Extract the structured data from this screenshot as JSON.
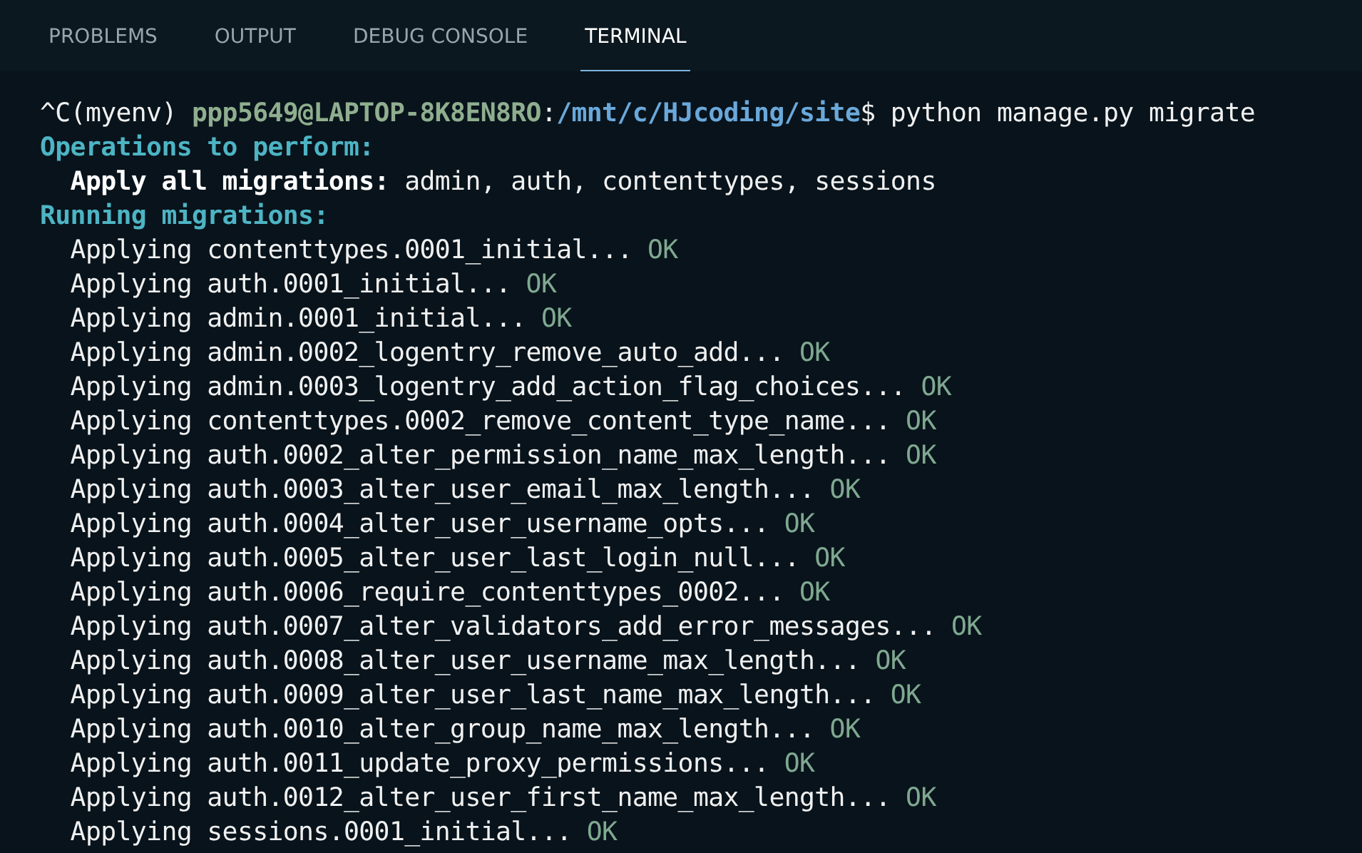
{
  "tabs": [
    {
      "label": "PROBLEMS",
      "selected": false
    },
    {
      "label": "OUTPUT",
      "selected": false
    },
    {
      "label": "DEBUG CONSOLE",
      "selected": false
    },
    {
      "label": "TERMINAL",
      "selected": true
    }
  ],
  "terminal": {
    "lines": [
      [
        {
          "kind": "plain",
          "text": "^C(myenv) "
        },
        {
          "kind": "user",
          "text": "ppp5649@LAPTOP-8K8EN8RO"
        },
        {
          "kind": "plain",
          "text": ":"
        },
        {
          "kind": "path",
          "text": "/mnt/c/HJcoding/site"
        },
        {
          "kind": "plain",
          "text": "$ python manage.py migrate"
        }
      ],
      [
        {
          "kind": "heading",
          "text": "Operations to perform:"
        }
      ],
      [
        {
          "kind": "label",
          "text": "  Apply all migrations:"
        },
        {
          "kind": "plain",
          "text": " admin, auth, contenttypes, sessions"
        }
      ],
      [
        {
          "kind": "heading",
          "text": "Running migrations:"
        }
      ],
      [
        {
          "kind": "plain",
          "text": "  Applying contenttypes.0001_initial... "
        },
        {
          "kind": "ok",
          "text": "OK"
        }
      ],
      [
        {
          "kind": "plain",
          "text": "  Applying auth.0001_initial... "
        },
        {
          "kind": "ok",
          "text": "OK"
        }
      ],
      [
        {
          "kind": "plain",
          "text": "  Applying admin.0001_initial... "
        },
        {
          "kind": "ok",
          "text": "OK"
        }
      ],
      [
        {
          "kind": "plain",
          "text": "  Applying admin.0002_logentry_remove_auto_add... "
        },
        {
          "kind": "ok",
          "text": "OK"
        }
      ],
      [
        {
          "kind": "plain",
          "text": "  Applying admin.0003_logentry_add_action_flag_choices... "
        },
        {
          "kind": "ok",
          "text": "OK"
        }
      ],
      [
        {
          "kind": "plain",
          "text": "  Applying contenttypes.0002_remove_content_type_name... "
        },
        {
          "kind": "ok",
          "text": "OK"
        }
      ],
      [
        {
          "kind": "plain",
          "text": "  Applying auth.0002_alter_permission_name_max_length... "
        },
        {
          "kind": "ok",
          "text": "OK"
        }
      ],
      [
        {
          "kind": "plain",
          "text": "  Applying auth.0003_alter_user_email_max_length... "
        },
        {
          "kind": "ok",
          "text": "OK"
        }
      ],
      [
        {
          "kind": "plain",
          "text": "  Applying auth.0004_alter_user_username_opts... "
        },
        {
          "kind": "ok",
          "text": "OK"
        }
      ],
      [
        {
          "kind": "plain",
          "text": "  Applying auth.0005_alter_user_last_login_null... "
        },
        {
          "kind": "ok",
          "text": "OK"
        }
      ],
      [
        {
          "kind": "plain",
          "text": "  Applying auth.0006_require_contenttypes_0002... "
        },
        {
          "kind": "ok",
          "text": "OK"
        }
      ],
      [
        {
          "kind": "plain",
          "text": "  Applying auth.0007_alter_validators_add_error_messages... "
        },
        {
          "kind": "ok",
          "text": "OK"
        }
      ],
      [
        {
          "kind": "plain",
          "text": "  Applying auth.0008_alter_user_username_max_length... "
        },
        {
          "kind": "ok",
          "text": "OK"
        }
      ],
      [
        {
          "kind": "plain",
          "text": "  Applying auth.0009_alter_user_last_name_max_length... "
        },
        {
          "kind": "ok",
          "text": "OK"
        }
      ],
      [
        {
          "kind": "plain",
          "text": "  Applying auth.0010_alter_group_name_max_length... "
        },
        {
          "kind": "ok",
          "text": "OK"
        }
      ],
      [
        {
          "kind": "plain",
          "text": "  Applying auth.0011_update_proxy_permissions... "
        },
        {
          "kind": "ok",
          "text": "OK"
        }
      ],
      [
        {
          "kind": "plain",
          "text": "  Applying auth.0012_alter_user_first_name_max_length... "
        },
        {
          "kind": "ok",
          "text": "OK"
        }
      ],
      [
        {
          "kind": "plain",
          "text": "  Applying sessions.0001_initial... "
        },
        {
          "kind": "ok",
          "text": "OK"
        }
      ]
    ]
  }
}
